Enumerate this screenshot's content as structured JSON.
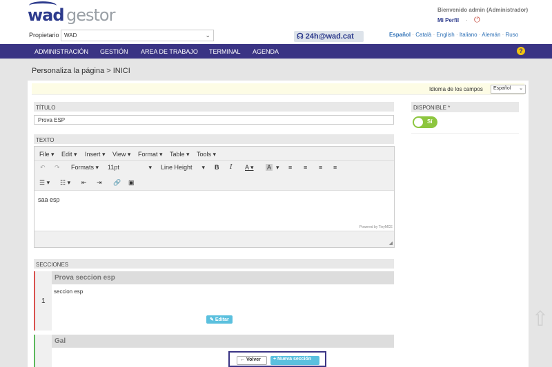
{
  "logo": {
    "part1": "wad",
    "part2": "gestor"
  },
  "header": {
    "owner_label": "Propietario",
    "owner_value": "WAD",
    "phone": "24h@wad.cat",
    "welcome": "Bienvenido admin (Administrador)",
    "profile": "Mi Perfil",
    "separator": "·",
    "languages": [
      "Español",
      "Català",
      "English",
      "Italiano",
      "Alemán",
      "Ruso"
    ],
    "lang_sep": " · "
  },
  "nav": {
    "items": [
      "ADMINISTRACIÓN",
      "GESTIÓN",
      "AREA DE TRABAJO",
      "TERMINAL",
      "AGENDA"
    ],
    "help": "?"
  },
  "breadcrumb": "Personaliza la página > INICI",
  "lang_bar": {
    "label": "Idioma de los campos",
    "value": "Español"
  },
  "form": {
    "title_label": "TÍTULO",
    "title_value": "Prova ESP",
    "text_label": "TEXTO",
    "available_label": "DISPONIBLE *",
    "toggle_text": "Sí",
    "sections_label": "SECCIONES"
  },
  "editor": {
    "menus": [
      "File",
      "Edit",
      "Insert",
      "View",
      "Format",
      "Table",
      "Tools"
    ],
    "formats": "Formats",
    "font_size": "11pt",
    "line_height": "Line Height",
    "content": "saa esp",
    "powered": "Powered by TinyMCE"
  },
  "sections": [
    {
      "number": "1",
      "title": "Prova seccion esp",
      "body": "seccion esp",
      "edit_label": "Editar",
      "color": "#d9534f"
    },
    {
      "title": "Gal",
      "color": "#5cb85c"
    }
  ],
  "actions": {
    "back": "Volver",
    "new_section": "Nueva sección"
  },
  "colors": {
    "nav": "#3a3484",
    "brand": "#2c3a8c",
    "accent": "#5bc0de",
    "toggle": "#8dc63f"
  }
}
